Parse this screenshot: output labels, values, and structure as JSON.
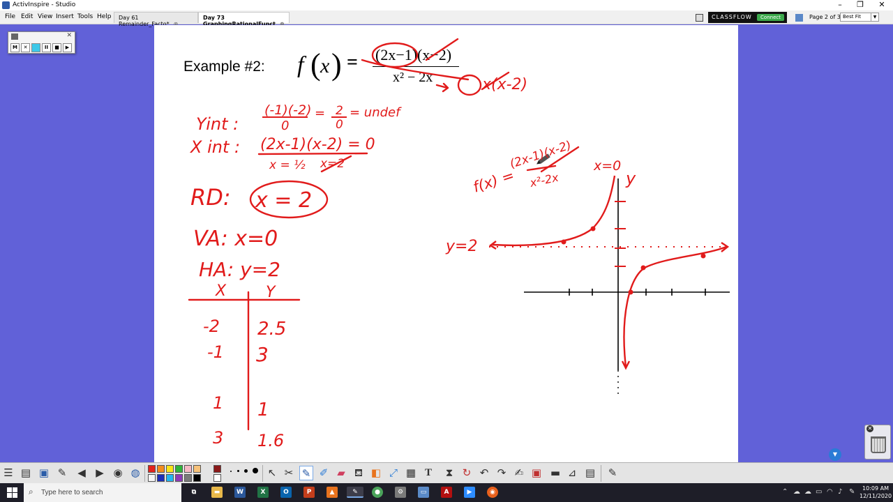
{
  "window": {
    "title": "ActivInspire - Studio",
    "controls": {
      "minimize": "–",
      "restore": "❐",
      "close": "✕"
    }
  },
  "menu": [
    "File",
    "Edit",
    "View",
    "Insert",
    "Tools",
    "Help"
  ],
  "tabs": [
    {
      "label": "Day 61 Remainder_Facto*",
      "active": false
    },
    {
      "label": "Day 73 GraphingRationalFunct",
      "active": true
    }
  ],
  "classflow": {
    "brand": "CLASSFLOW",
    "connect_label": "Connect"
  },
  "page_indicator": "Page 2 of 3",
  "zoom": {
    "selected": "Best Fit"
  },
  "flipchart": {
    "example_label": "Example #2:",
    "function_name": "f",
    "function_var": "x",
    "equals": "=",
    "numerator": "(2x−1)(x−2)",
    "denominator": "x² − 2x",
    "handwritten_ink_color": "#e11b1b",
    "notes": {
      "yint_label": "Yint :",
      "yint_num": "(-1)(-2)",
      "yint_den": "0",
      "yint_eq": "=",
      "yint_frac_num": "2",
      "yint_frac_den": "0",
      "yint_result": "= undef",
      "xint_label": "X int :",
      "xint_expr": "(2x-1)(x-2) = 0",
      "xint_solution1": "x = ½",
      "xint_solution2": "x=2",
      "factored_denominator": "x(x-2)",
      "rd": "RD:",
      "rd_value": "x = 2",
      "va": "VA: x=0",
      "ha": "HA: y=2",
      "graph_fx_num": "(2x-1)(x-2)",
      "graph_fx_left": "f(x) =",
      "graph_fx_den": "x²-2x",
      "graph_va_label": "x=0",
      "graph_y_label": "y",
      "graph_ha_label": "y=2"
    },
    "table": {
      "headers": [
        "X",
        "Y"
      ],
      "rows": [
        [
          "-2",
          "2.5"
        ],
        [
          "-1",
          "3"
        ],
        [
          "1",
          "1"
        ],
        [
          "3",
          "1.6"
        ]
      ]
    }
  },
  "mini_toolbar": {
    "buttons": [
      "M",
      "✕",
      "●",
      "II",
      "■",
      "▶"
    ]
  },
  "palette_colors": [
    "#e3231c",
    "#f28c1e",
    "#f9e416",
    "#2fb43a",
    "#f6b9c4",
    "#8b1a1a",
    "#f5f5f5",
    "#1c2db8",
    "#22b6f0",
    "#8e3ab8",
    "#7a7a7a",
    "#000000"
  ],
  "taskbar": {
    "search_placeholder": "Type here to search",
    "time": "10:09 AM",
    "date": "12/11/2020"
  }
}
